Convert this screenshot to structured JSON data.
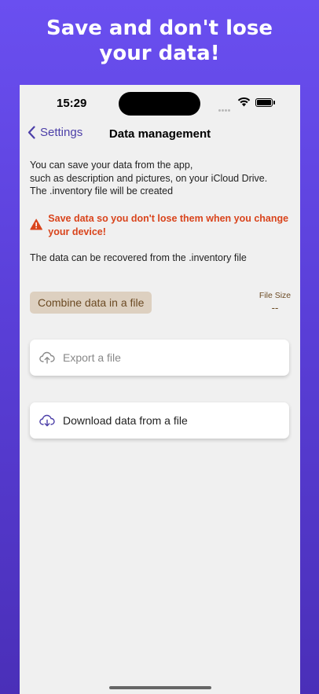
{
  "headline": {
    "line1": "Save and don't lose",
    "line2": "your data!"
  },
  "status_bar": {
    "time": "15:29"
  },
  "nav": {
    "back_label": "Settings",
    "title": "Data management"
  },
  "description": {
    "line1": "You can save your data from the app,",
    "line2": "such as description and pictures, on your iCloud Drive.",
    "line3": "The .inventory file will be created"
  },
  "warning": {
    "text": "Save data so you don't lose them when you change your device!",
    "color": "#d9441c"
  },
  "recover_text": "The data can be recovered from the .inventory file",
  "combine_button": {
    "label": "Combine data in a file"
  },
  "file_size": {
    "label": "File Size",
    "value": "--"
  },
  "actions": {
    "export_label": "Export a file",
    "download_label": "Download data from a file"
  },
  "colors": {
    "accent": "#4c3fa8",
    "background_top": "#6a4ff0",
    "background_bottom": "#4a2fb8"
  }
}
